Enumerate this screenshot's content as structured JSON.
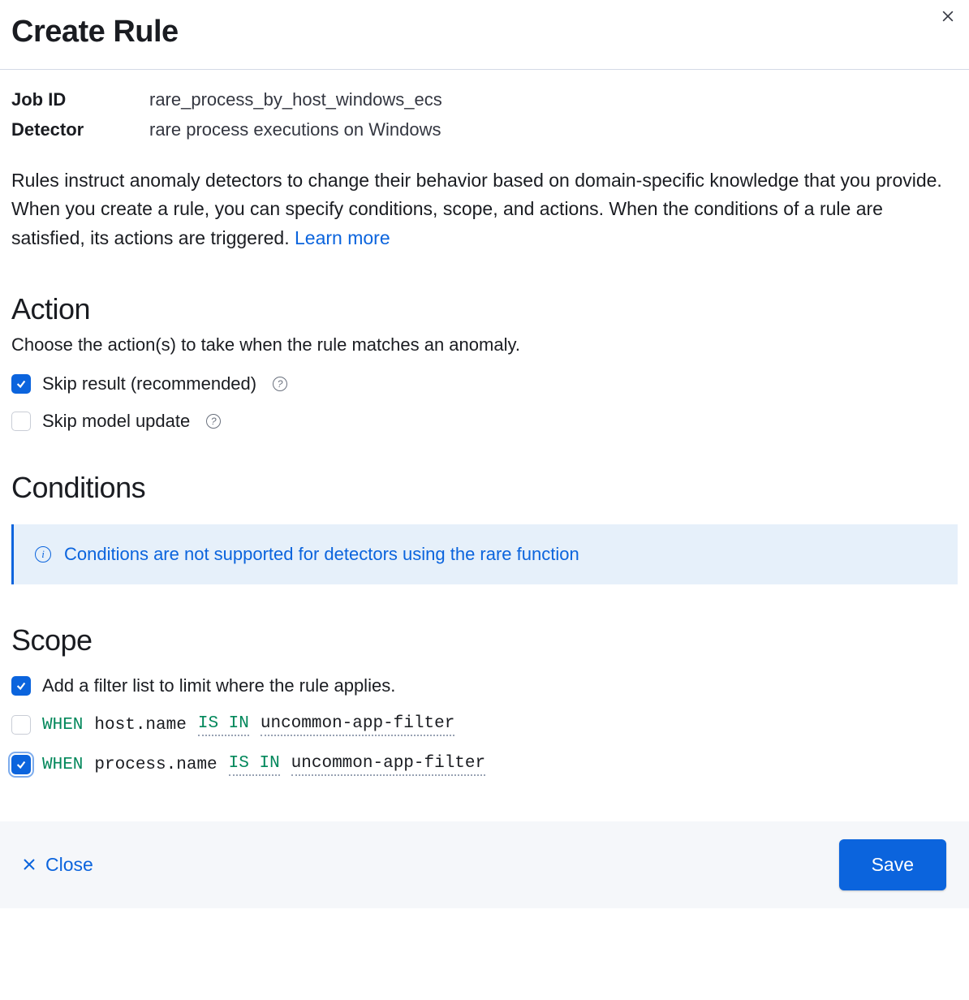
{
  "dialog": {
    "title": "Create Rule"
  },
  "meta": {
    "job_id_label": "Job ID",
    "job_id_value": "rare_process_by_host_windows_ecs",
    "detector_label": "Detector",
    "detector_value": "rare process executions on Windows"
  },
  "intro": {
    "text": "Rules instruct anomaly detectors to change their behavior based on domain-specific knowledge that you provide. When you create a rule, you can specify conditions, scope, and actions. When the conditions of a rule are satisfied, its actions are triggered. ",
    "learn_more": "Learn more"
  },
  "action": {
    "heading": "Action",
    "subheading": "Choose the action(s) to take when the rule matches an anomaly.",
    "skip_result": {
      "label": "Skip result (recommended)",
      "checked": true
    },
    "skip_model": {
      "label": "Skip model update",
      "checked": false
    }
  },
  "conditions": {
    "heading": "Conditions",
    "callout": "Conditions are not supported for detectors using the rare function"
  },
  "scope": {
    "heading": "Scope",
    "add_filter_label": "Add a filter list to limit where the rule applies.",
    "add_filter_checked": true,
    "rows": [
      {
        "checked": false,
        "when": "WHEN",
        "field": "host.name",
        "op": "IS IN",
        "filter": "uncommon-app-filter"
      },
      {
        "checked": true,
        "when": "WHEN",
        "field": "process.name",
        "op": "IS IN",
        "filter": "uncommon-app-filter"
      }
    ]
  },
  "footer": {
    "close": "Close",
    "save": "Save"
  }
}
